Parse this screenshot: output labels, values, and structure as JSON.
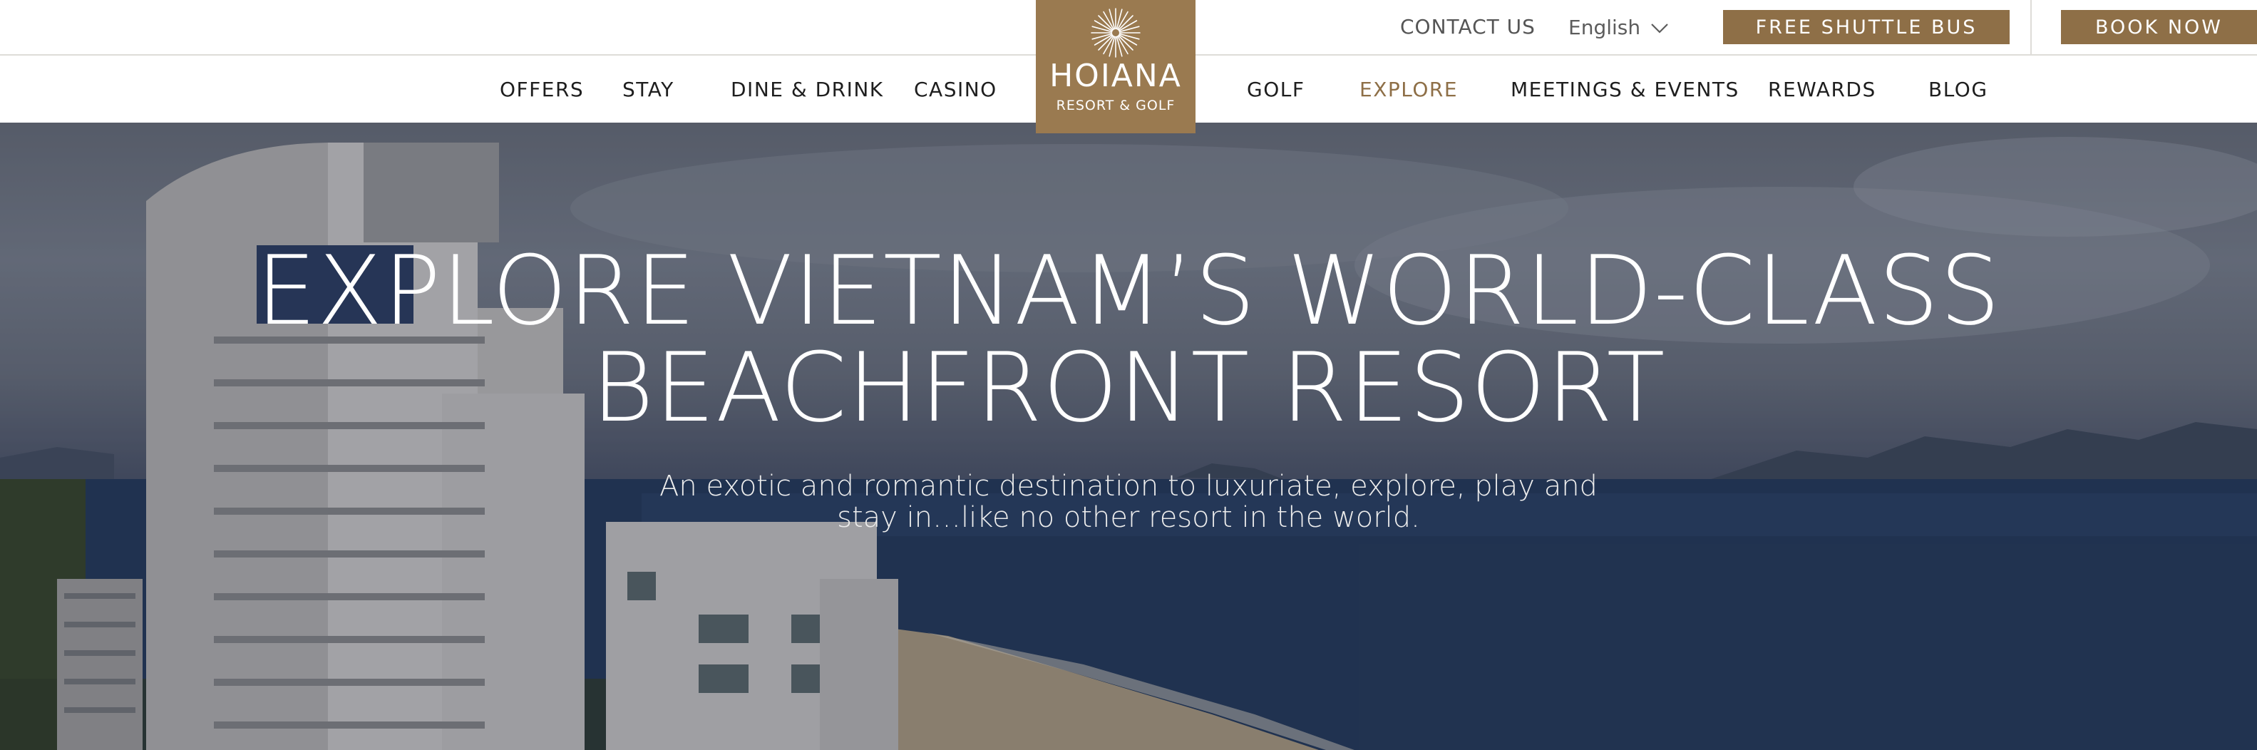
{
  "header": {
    "contact_label": "CONTACT US",
    "language": "English",
    "shuttle_label": "FREE SHUTTLE BUS",
    "book_label": "BOOK NOW"
  },
  "nav": {
    "items": [
      {
        "label": "OFFERS"
      },
      {
        "label": "STAY"
      },
      {
        "label": "DINE & DRINK"
      },
      {
        "label": "CASINO"
      },
      {
        "label": "GOLF"
      },
      {
        "label": "EXPLORE"
      },
      {
        "label": "MEETINGS & EVENTS"
      },
      {
        "label": "REWARDS"
      },
      {
        "label": "BLOG"
      }
    ],
    "active": "EXPLORE"
  },
  "logo": {
    "name": "HOIANA",
    "tagline": "RESORT & GOLF"
  },
  "hero": {
    "heading_line1": "EXPLORE VIETNAM’S WORLD-CLASS",
    "heading_line2": "BEACHFRONT RESORT",
    "subheading_line1": "An exotic and romantic destination to luxuriate, explore, play and",
    "subheading_line2": "stay in…like no other resort in the world."
  },
  "colors": {
    "brand_gold": "#8e6f47",
    "logo_gold": "#9a7a50",
    "nav_text": "#1e1e1e",
    "active_nav": "#8e6f47"
  },
  "icons": {
    "language_toggle": "chevron-down-icon",
    "logo_mark": "sunburst-icon"
  }
}
